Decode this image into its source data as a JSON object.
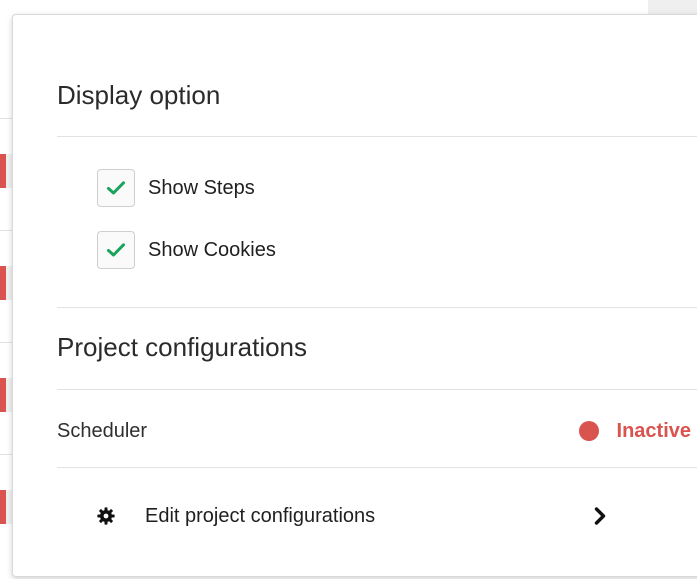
{
  "display_options": {
    "title": "Display option",
    "items": [
      {
        "label": "Show Steps",
        "checked": true
      },
      {
        "label": "Show Cookies",
        "checked": true
      }
    ]
  },
  "project_configurations": {
    "title": "Project configurations",
    "scheduler": {
      "label": "Scheduler",
      "status": "Inactive",
      "status_color": "#d9534f"
    },
    "edit": {
      "label": "Edit project configurations",
      "icon": "gear-icon",
      "chevron": "chevron-right-icon"
    }
  },
  "colors": {
    "check": "#1aa35c",
    "inactive": "#d9534f"
  }
}
